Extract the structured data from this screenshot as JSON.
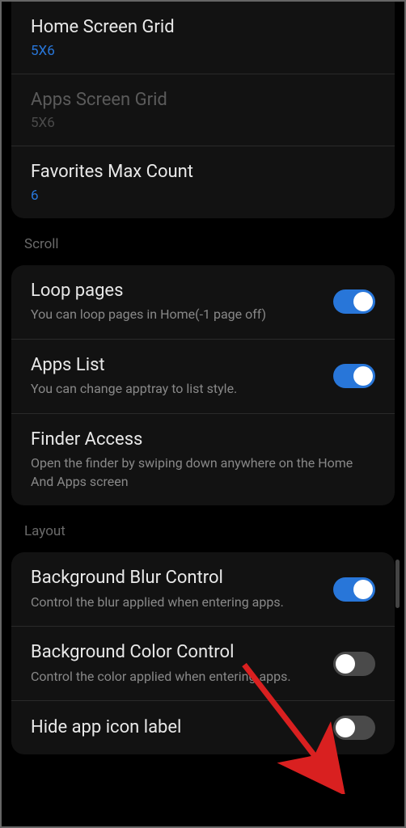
{
  "group_grid": {
    "home_grid": {
      "title": "Home Screen Grid",
      "value": "5X6"
    },
    "apps_grid": {
      "title": "Apps Screen Grid",
      "value": "5X6"
    },
    "favorites": {
      "title": "Favorites Max Count",
      "value": "6"
    }
  },
  "section_scroll": {
    "header": "Scroll",
    "loop_pages": {
      "title": "Loop pages",
      "subtitle": "You can loop pages in Home(-1 page off)",
      "toggle": true
    },
    "apps_list": {
      "title": "Apps List",
      "subtitle": "You can change apptray to list style.",
      "toggle": true
    },
    "finder_access": {
      "title": "Finder Access",
      "subtitle": "Open the finder by swiping down anywhere on the Home And Apps screen"
    }
  },
  "section_layout": {
    "header": "Layout",
    "blur_control": {
      "title": "Background Blur Control",
      "subtitle": "Control the blur applied when entering apps.",
      "toggle": true
    },
    "color_control": {
      "title": "Background Color Control",
      "subtitle": "Control the color applied when entering apps.",
      "toggle": false
    },
    "hide_label": {
      "title": "Hide app icon label",
      "toggle": false
    }
  },
  "colors": {
    "accent_blue": "#2876d9",
    "arrow_red": "#d92020"
  }
}
